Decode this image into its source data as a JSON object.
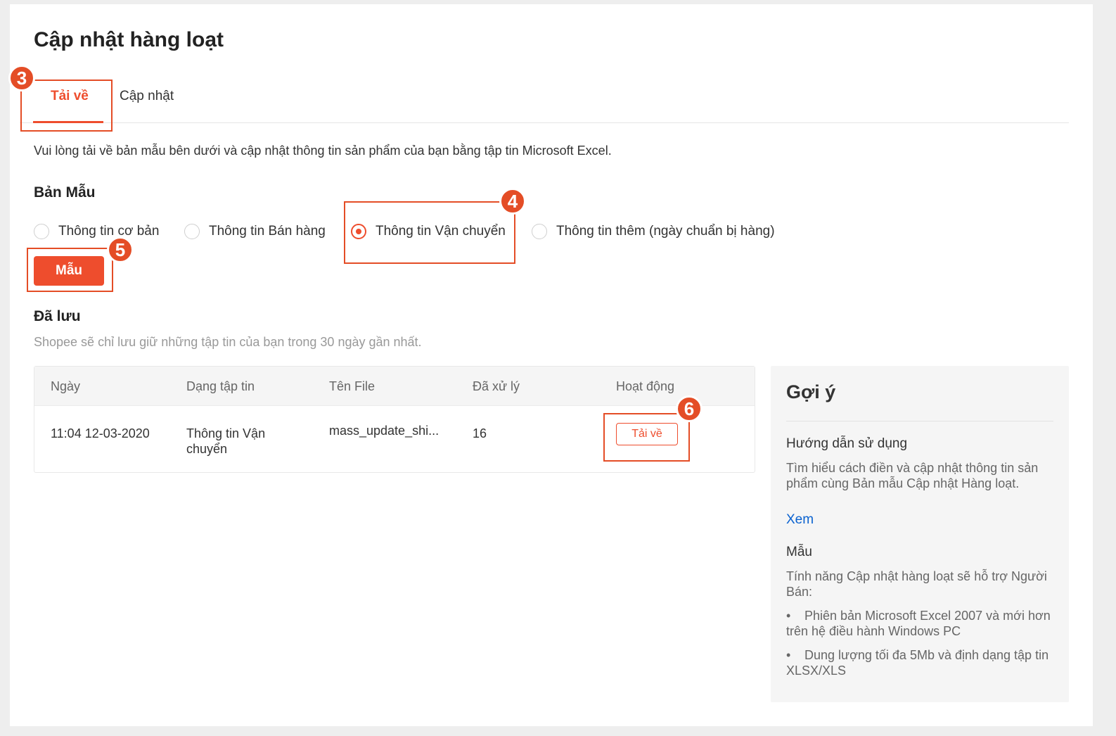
{
  "page": {
    "title": "Cập nhật hàng loạt"
  },
  "tabs": [
    {
      "label": "Tải về",
      "active": true
    },
    {
      "label": "Cập nhật",
      "active": false
    }
  ],
  "intro": "Vui lòng tải về bản mẫu bên dưới và cập nhật thông tin sản phẩm của bạn bằng tập tin Microsoft Excel.",
  "template_section": {
    "title": "Bản Mẫu",
    "options": [
      {
        "label": "Thông tin cơ bản",
        "selected": false
      },
      {
        "label": "Thông tin Bán hàng",
        "selected": false
      },
      {
        "label": "Thông tin Vận chuyển",
        "selected": true
      },
      {
        "label": "Thông tin thêm (ngày chuẩn bị hàng)",
        "selected": false
      }
    ],
    "button_label": "Mẫu"
  },
  "saved_section": {
    "title": "Đã lưu",
    "note": "Shopee sẽ chỉ lưu giữ những tập tin của bạn trong 30 ngày gần nhất."
  },
  "table": {
    "headers": [
      "Ngày",
      "Dạng tập tin",
      "Tên File",
      "Đã xử lý",
      "Hoạt động"
    ],
    "rows": [
      {
        "date": "11:04 12-03-2020",
        "type": "Thông tin Vận chuyển",
        "file_name": "mass_update_shi...",
        "processed": "16",
        "action": "Tải về"
      }
    ]
  },
  "hint": {
    "title": "Gợi ý",
    "guide_heading": "Hướng dẫn sử dụng",
    "guide_text": "Tìm hiểu cách điền và cập nhật thông tin sản phẩm cùng Bản mẫu Cập nhật Hàng loạt.",
    "guide_link": "Xem",
    "template_heading": "Mẫu",
    "template_text": "Tính năng Cập nhật hàng loạt sẽ hỗ trợ Người Bán:",
    "bullets": [
      "Phiên bản Microsoft Excel 2007 và mới hơn trên hệ điều hành Windows PC",
      "Dung lượng tối đa 5Mb và định dạng tập tin XLSX/XLS"
    ]
  },
  "annotations": [
    "3",
    "4",
    "5",
    "6"
  ],
  "colors": {
    "accent": "#ee4d2d",
    "link": "#0a62d0",
    "annotation": "#e44d26"
  }
}
